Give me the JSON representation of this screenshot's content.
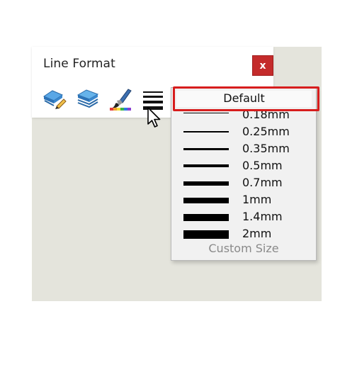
{
  "window": {
    "title": "Line Format",
    "close_label": "x"
  },
  "toolbar": {
    "tools": [
      {
        "name": "line-color-pencil-icon"
      },
      {
        "name": "line-color-stack-icon"
      },
      {
        "name": "paintbrush-color-icon"
      },
      {
        "name": "line-width-icon"
      }
    ]
  },
  "dropdown": {
    "default_label": "Default",
    "items": [
      {
        "label": "0.18mm"
      },
      {
        "label": "0.25mm"
      },
      {
        "label": "0.35mm"
      },
      {
        "label": "0.5mm"
      },
      {
        "label": "0.7mm"
      },
      {
        "label": "1mm"
      },
      {
        "label": "1.4mm"
      },
      {
        "label": "2mm"
      }
    ],
    "custom_label": "Custom Size"
  },
  "colors": {
    "highlight": "#d71d1d",
    "close": "#c42b2b",
    "workspace": "#e4e4dc"
  }
}
